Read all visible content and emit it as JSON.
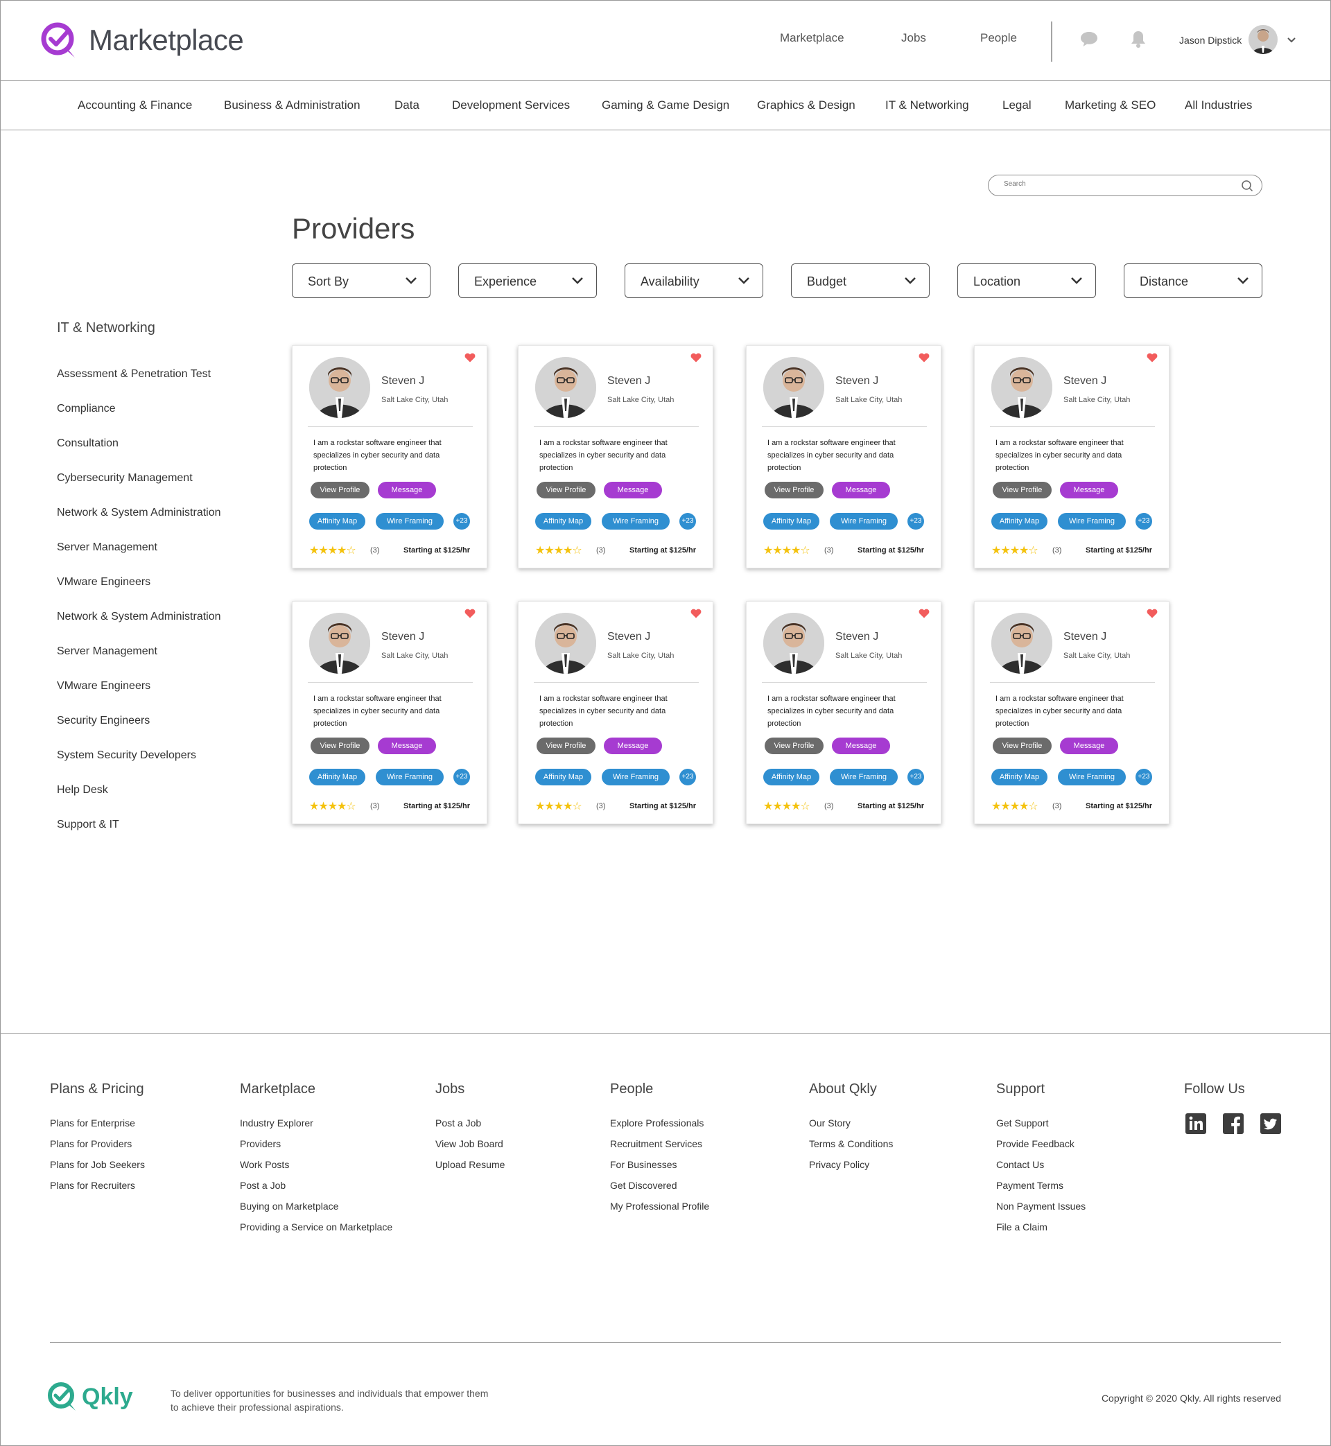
{
  "brand": {
    "name": "Marketplace",
    "accent": "#a63bd1",
    "footer_brand": "Qkly",
    "footer_accent": "#2daa8e"
  },
  "topnav": {
    "items": [
      "Marketplace",
      "Jobs",
      "People"
    ]
  },
  "user": {
    "name": "Jason Dipstick"
  },
  "icons": {
    "chat": "chat-bubble-icon",
    "bell": "bell-icon",
    "search": "search-icon",
    "caret": "chevron-down-icon",
    "heart": "heart-icon"
  },
  "categories": [
    "Accounting & Finance",
    "Business & Administration",
    "Data",
    "Development Services",
    "Gaming & Game Design",
    "Graphics & Design",
    "IT & Networking",
    "Legal",
    "Marketing & SEO",
    "All Industries"
  ],
  "search": {
    "placeholder": "Search"
  },
  "page": {
    "title": "Providers"
  },
  "filters": [
    "Sort By",
    "Experience",
    "Availability",
    "Budget",
    "Location",
    "Distance"
  ],
  "sidebar": {
    "title": "IT & Networking",
    "items": [
      "Assessment & Penetration Test",
      "Compliance",
      "Consultation",
      "Cybersecurity Management",
      "Network & System Administration",
      "Server Management",
      "VMware Engineers",
      "Network & System Administration",
      "Server Management",
      "VMware Engineers",
      "Security Engineers",
      "System Security Developers",
      "Help Desk",
      "Support & IT"
    ]
  },
  "card_template": {
    "name": "Steven J",
    "location": "Salt Lake City, Utah",
    "bio": "I am a rockstar software engineer that specializes in cyber security and data protection",
    "view_label": "View Profile",
    "message_label": "Message",
    "tags": [
      "Affinity Map",
      "Wire Framing"
    ],
    "more": "+23",
    "rating": 4,
    "rating_max": 5,
    "review_count": "(3)",
    "price": "Starting at $125/hr"
  },
  "card_count": 8,
  "footer": {
    "columns": [
      {
        "title": "Plans & Pricing",
        "links": [
          "Plans for Enterprise",
          "Plans for Providers",
          "Plans for Job Seekers",
          "Plans for Recruiters"
        ]
      },
      {
        "title": "Marketplace",
        "links": [
          "Industry Explorer",
          "Providers",
          "Work Posts",
          "Post a Job",
          "Buying on Marketplace",
          "Providing a Service on Marketplace"
        ]
      },
      {
        "title": "Jobs",
        "links": [
          "Post a Job",
          "View Job Board",
          "Upload Resume"
        ]
      },
      {
        "title": "People",
        "links": [
          "Explore Professionals",
          "Recruitment Services",
          "For Businesses",
          "Get Discovered",
          "My Professional Profile"
        ]
      },
      {
        "title": "About Qkly",
        "links": [
          "Our Story",
          "Terms & Conditions",
          "Privacy Policy"
        ]
      },
      {
        "title": "Support",
        "links": [
          "Get Support",
          "Provide Feedback",
          "Contact Us",
          "Payment Terms",
          "Non Payment Issues",
          "File a Claim"
        ]
      },
      {
        "title": "Follow Us",
        "links": []
      }
    ],
    "social": [
      "linkedin-icon",
      "facebook-icon",
      "twitter-icon"
    ],
    "tagline": "To deliver opportunities for businesses and individuals that empower them to achieve their professional aspirations.",
    "copyright": "Copyright © 2020 Qkly. All rights reserved"
  }
}
